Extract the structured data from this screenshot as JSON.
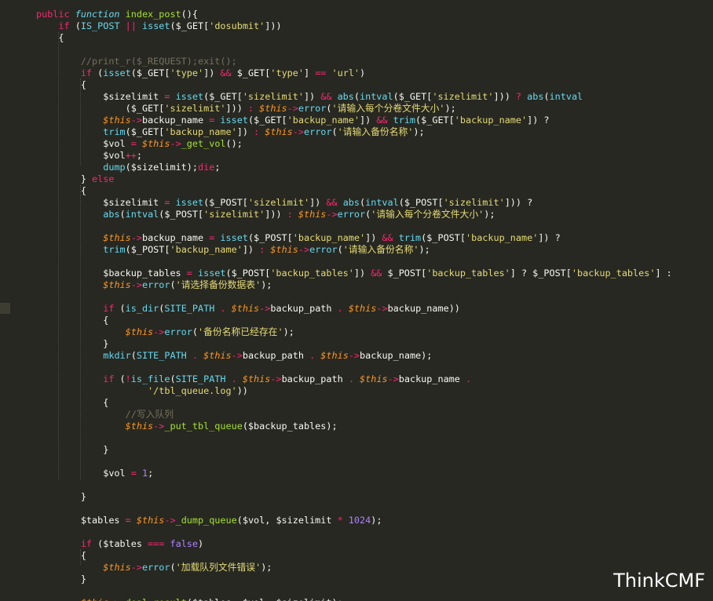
{
  "watermark": "ThinkCMF",
  "colors": {
    "background": "#272822",
    "keyword": "#f92672",
    "function": "#66d9ef",
    "method": "#a6e22e",
    "string": "#e6db74",
    "comment": "#75715e",
    "this": "#fd971f",
    "number": "#ae81ff"
  },
  "code_lines": [
    [
      [
        "k",
        "public "
      ],
      [
        "ti",
        "function "
      ],
      [
        "fn",
        "index_post"
      ],
      [
        "v",
        "(){"
      ]
    ],
    [
      [
        "v",
        "    "
      ],
      [
        "k",
        "if "
      ],
      [
        "v",
        "("
      ],
      [
        "cn",
        "IS_POST "
      ],
      [
        "o",
        "|| "
      ],
      [
        "f",
        "isset"
      ],
      [
        "v",
        "($_GET["
      ],
      [
        "s",
        "'dosubmit'"
      ],
      [
        "v",
        "]))"
      ]
    ],
    [
      [
        "v",
        "    {"
      ]
    ],
    [],
    [
      [
        "v",
        "        "
      ],
      [
        "c",
        "//print_r($_REQUEST);exit();"
      ]
    ],
    [
      [
        "v",
        "        "
      ],
      [
        "k",
        "if "
      ],
      [
        "v",
        "("
      ],
      [
        "f",
        "isset"
      ],
      [
        "v",
        "($_GET["
      ],
      [
        "s",
        "'type'"
      ],
      [
        "v",
        "]) "
      ],
      [
        "o",
        "&& "
      ],
      [
        "v",
        "$_GET["
      ],
      [
        "s",
        "'type'"
      ],
      [
        "v",
        "] "
      ],
      [
        "o",
        "== "
      ],
      [
        "s",
        "'url'"
      ],
      [
        "v",
        ")"
      ]
    ],
    [
      [
        "v",
        "        {"
      ]
    ],
    [
      [
        "v",
        "            $sizelimit "
      ],
      [
        "o",
        "= "
      ],
      [
        "f",
        "isset"
      ],
      [
        "v",
        "($_GET["
      ],
      [
        "s",
        "'sizelimit'"
      ],
      [
        "v",
        "]) "
      ],
      [
        "o",
        "&& "
      ],
      [
        "f",
        "abs"
      ],
      [
        "v",
        "("
      ],
      [
        "f",
        "intval"
      ],
      [
        "v",
        "($_GET["
      ],
      [
        "s",
        "'sizelimit'"
      ],
      [
        "v",
        "])) "
      ],
      [
        "o",
        "? "
      ],
      [
        "f",
        "abs"
      ],
      [
        "v",
        "("
      ],
      [
        "f",
        "intval"
      ]
    ],
    [
      [
        "v",
        "                ($_GET["
      ],
      [
        "s",
        "'sizelimit'"
      ],
      [
        "v",
        "])) "
      ],
      [
        "o",
        ": "
      ],
      [
        "th",
        "$this"
      ],
      [
        "o",
        "->"
      ],
      [
        "f",
        "error"
      ],
      [
        "v",
        "("
      ],
      [
        "s",
        "'请输入每个分卷文件大小'"
      ],
      [
        "v",
        ");"
      ]
    ],
    [
      [
        "v",
        "            "
      ],
      [
        "th",
        "$this"
      ],
      [
        "o",
        "->"
      ],
      [
        "v",
        "backup_name "
      ],
      [
        "o",
        "= "
      ],
      [
        "f",
        "isset"
      ],
      [
        "v",
        "($_GET["
      ],
      [
        "s",
        "'backup_name'"
      ],
      [
        "v",
        "]) "
      ],
      [
        "o",
        "&& "
      ],
      [
        "f",
        "trim"
      ],
      [
        "v",
        "($_GET["
      ],
      [
        "s",
        "'backup_name'"
      ],
      [
        "v",
        "]) ?"
      ]
    ],
    [
      [
        "v",
        "            "
      ],
      [
        "f",
        "trim"
      ],
      [
        "v",
        "($_GET["
      ],
      [
        "s",
        "'backup_name'"
      ],
      [
        "v",
        "]) "
      ],
      [
        "o",
        ": "
      ],
      [
        "th",
        "$this"
      ],
      [
        "o",
        "->"
      ],
      [
        "f",
        "error"
      ],
      [
        "v",
        "("
      ],
      [
        "s",
        "'请输入备份名称'"
      ],
      [
        "v",
        ");"
      ]
    ],
    [
      [
        "v",
        "            $vol "
      ],
      [
        "o",
        "= "
      ],
      [
        "th",
        "$this"
      ],
      [
        "o",
        "->"
      ],
      [
        "fn",
        "_get_vol"
      ],
      [
        "v",
        "();"
      ]
    ],
    [
      [
        "v",
        "            $vol"
      ],
      [
        "o",
        "++"
      ],
      [
        "v",
        ";"
      ]
    ],
    [
      [
        "v",
        "            "
      ],
      [
        "f",
        "dump"
      ],
      [
        "v",
        "($sizelimit);"
      ],
      [
        "k",
        "die"
      ],
      [
        "v",
        ";"
      ]
    ],
    [
      [
        "v",
        "        } "
      ],
      [
        "k",
        "else"
      ]
    ],
    [
      [
        "v",
        "        {"
      ]
    ],
    [
      [
        "v",
        "            $sizelimit "
      ],
      [
        "o",
        "= "
      ],
      [
        "f",
        "isset"
      ],
      [
        "v",
        "($_POST["
      ],
      [
        "s",
        "'sizelimit'"
      ],
      [
        "v",
        "]) "
      ],
      [
        "o",
        "&& "
      ],
      [
        "f",
        "abs"
      ],
      [
        "v",
        "("
      ],
      [
        "f",
        "intval"
      ],
      [
        "v",
        "($_POST["
      ],
      [
        "s",
        "'sizelimit'"
      ],
      [
        "v",
        "])) ?"
      ]
    ],
    [
      [
        "v",
        "            "
      ],
      [
        "f",
        "abs"
      ],
      [
        "v",
        "("
      ],
      [
        "f",
        "intval"
      ],
      [
        "v",
        "($_POST["
      ],
      [
        "s",
        "'sizelimit'"
      ],
      [
        "v",
        "])) "
      ],
      [
        "o",
        ": "
      ],
      [
        "th",
        "$this"
      ],
      [
        "o",
        "->"
      ],
      [
        "f",
        "error"
      ],
      [
        "v",
        "("
      ],
      [
        "s",
        "'请输入每个分卷文件大小'"
      ],
      [
        "v",
        ");"
      ]
    ],
    [],
    [
      [
        "v",
        "            "
      ],
      [
        "th",
        "$this"
      ],
      [
        "o",
        "->"
      ],
      [
        "v",
        "backup_name "
      ],
      [
        "o",
        "= "
      ],
      [
        "f",
        "isset"
      ],
      [
        "v",
        "($_POST["
      ],
      [
        "s",
        "'backup_name'"
      ],
      [
        "v",
        "]) "
      ],
      [
        "o",
        "&& "
      ],
      [
        "f",
        "trim"
      ],
      [
        "v",
        "($_POST["
      ],
      [
        "s",
        "'backup_name'"
      ],
      [
        "v",
        "]) ?"
      ]
    ],
    [
      [
        "v",
        "            "
      ],
      [
        "f",
        "trim"
      ],
      [
        "v",
        "($_POST["
      ],
      [
        "s",
        "'backup_name'"
      ],
      [
        "v",
        "]) "
      ],
      [
        "o",
        ": "
      ],
      [
        "th",
        "$this"
      ],
      [
        "o",
        "->"
      ],
      [
        "f",
        "error"
      ],
      [
        "v",
        "("
      ],
      [
        "s",
        "'请输入备份名称'"
      ],
      [
        "v",
        ");"
      ]
    ],
    [],
    [
      [
        "v",
        "            $backup_tables "
      ],
      [
        "o",
        "= "
      ],
      [
        "f",
        "isset"
      ],
      [
        "v",
        "($_POST["
      ],
      [
        "s",
        "'backup_tables'"
      ],
      [
        "v",
        "]) "
      ],
      [
        "o",
        "&& "
      ],
      [
        "v",
        "$_POST["
      ],
      [
        "s",
        "'backup_tables'"
      ],
      [
        "v",
        "] ? $_POST["
      ],
      [
        "s",
        "'backup_tables'"
      ],
      [
        "v",
        "] :"
      ]
    ],
    [
      [
        "v",
        "            "
      ],
      [
        "th",
        "$this"
      ],
      [
        "o",
        "->"
      ],
      [
        "f",
        "error"
      ],
      [
        "v",
        "("
      ],
      [
        "s",
        "'请选择备份数据表'"
      ],
      [
        "v",
        ");"
      ]
    ],
    [],
    [
      [
        "v",
        "            "
      ],
      [
        "k",
        "if "
      ],
      [
        "v",
        "("
      ],
      [
        "f",
        "is_dir"
      ],
      [
        "v",
        "("
      ],
      [
        "cn",
        "SITE_PATH "
      ],
      [
        "o",
        ". "
      ],
      [
        "th",
        "$this"
      ],
      [
        "o",
        "->"
      ],
      [
        "v",
        "backup_path "
      ],
      [
        "o",
        ". "
      ],
      [
        "th",
        "$this"
      ],
      [
        "o",
        "->"
      ],
      [
        "v",
        "backup_name))"
      ]
    ],
    [
      [
        "v",
        "            {"
      ]
    ],
    [
      [
        "v",
        "                "
      ],
      [
        "th",
        "$this"
      ],
      [
        "o",
        "->"
      ],
      [
        "f",
        "error"
      ],
      [
        "v",
        "("
      ],
      [
        "s",
        "'备份名称已经存在'"
      ],
      [
        "v",
        ");"
      ]
    ],
    [
      [
        "v",
        "            }"
      ]
    ],
    [
      [
        "v",
        "            "
      ],
      [
        "f",
        "mkdir"
      ],
      [
        "v",
        "("
      ],
      [
        "cn",
        "SITE_PATH "
      ],
      [
        "o",
        ". "
      ],
      [
        "th",
        "$this"
      ],
      [
        "o",
        "->"
      ],
      [
        "v",
        "backup_path "
      ],
      [
        "o",
        ". "
      ],
      [
        "th",
        "$this"
      ],
      [
        "o",
        "->"
      ],
      [
        "v",
        "backup_name);"
      ]
    ],
    [],
    [
      [
        "v",
        "            "
      ],
      [
        "k",
        "if "
      ],
      [
        "v",
        "("
      ],
      [
        "o",
        "!"
      ],
      [
        "f",
        "is_file"
      ],
      [
        "v",
        "("
      ],
      [
        "cn",
        "SITE_PATH "
      ],
      [
        "o",
        ". "
      ],
      [
        "th",
        "$this"
      ],
      [
        "o",
        "->"
      ],
      [
        "v",
        "backup_path "
      ],
      [
        "o",
        ". "
      ],
      [
        "th",
        "$this"
      ],
      [
        "o",
        "->"
      ],
      [
        "v",
        "backup_name "
      ],
      [
        "o",
        "."
      ]
    ],
    [
      [
        "v",
        "                    "
      ],
      [
        "s",
        "'/tbl_queue.log'"
      ],
      [
        "v",
        "))"
      ]
    ],
    [
      [
        "v",
        "            {"
      ]
    ],
    [
      [
        "v",
        "                "
      ],
      [
        "c",
        "//写入队列"
      ]
    ],
    [
      [
        "v",
        "                "
      ],
      [
        "th",
        "$this"
      ],
      [
        "o",
        "->"
      ],
      [
        "fn",
        "_put_tbl_queue"
      ],
      [
        "v",
        "($backup_tables);"
      ]
    ],
    [],
    [
      [
        "v",
        "            }"
      ]
    ],
    [],
    [
      [
        "v",
        "            $vol "
      ],
      [
        "o",
        "= "
      ],
      [
        "n",
        "1"
      ],
      [
        "v",
        ";"
      ]
    ],
    [],
    [
      [
        "v",
        "        }"
      ]
    ],
    [],
    [
      [
        "v",
        "        $tables "
      ],
      [
        "o",
        "= "
      ],
      [
        "th",
        "$this"
      ],
      [
        "o",
        "->"
      ],
      [
        "fn",
        "_dump_queue"
      ],
      [
        "v",
        "($vol, $sizelimit "
      ],
      [
        "o",
        "* "
      ],
      [
        "n",
        "1024"
      ],
      [
        "v",
        ");"
      ]
    ],
    [],
    [
      [
        "v",
        "        "
      ],
      [
        "k",
        "if "
      ],
      [
        "v",
        "($tables "
      ],
      [
        "o",
        "=== "
      ],
      [
        "n",
        "false"
      ],
      [
        "v",
        ")"
      ]
    ],
    [
      [
        "v",
        "        {"
      ]
    ],
    [
      [
        "v",
        "            "
      ],
      [
        "th",
        "$this"
      ],
      [
        "o",
        "->"
      ],
      [
        "f",
        "error"
      ],
      [
        "v",
        "("
      ],
      [
        "s",
        "'加载队列文件错误'"
      ],
      [
        "v",
        ");"
      ]
    ],
    [
      [
        "v",
        "        }"
      ]
    ],
    [],
    [
      [
        "v",
        "        "
      ],
      [
        "th",
        "$this"
      ],
      [
        "o",
        "->"
      ],
      [
        "fn",
        "_deal_result"
      ],
      [
        "v",
        "($tables, $vol, $sizelimit);"
      ]
    ]
  ]
}
